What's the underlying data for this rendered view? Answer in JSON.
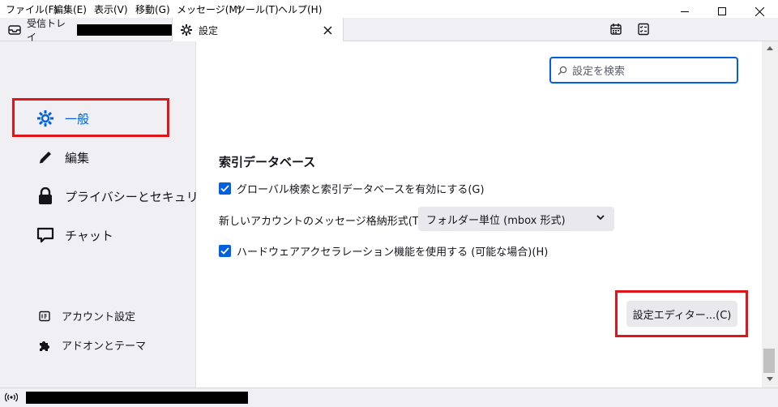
{
  "menu": {
    "items": [
      "ファイル(F)",
      "編集(E)",
      "表示(V)",
      "移動(G)",
      "メッセージ(M)",
      "ツール(T)",
      "ヘルプ(H)"
    ]
  },
  "window_controls": {
    "minimize": "—",
    "maximize": "☐",
    "close": "✕"
  },
  "tabs": [
    {
      "label": "受信トレイ",
      "icon": "mail-icon"
    },
    {
      "label": "設定",
      "icon": "gear-icon",
      "close": "✕"
    }
  ],
  "sidebar": {
    "categories": [
      {
        "label": "一般",
        "icon": "gear-icon",
        "selected": true
      },
      {
        "label": "編集",
        "icon": "pencil-icon"
      },
      {
        "label": "プライバシーとセキュリティ",
        "icon": "lock-icon"
      },
      {
        "label": "チャット",
        "icon": "chat-icon"
      }
    ],
    "footer": [
      {
        "label": "アカウント設定",
        "icon": "account-icon"
      },
      {
        "label": "アドオンとテーマ",
        "icon": "puzzle-icon"
      }
    ]
  },
  "search": {
    "placeholder": "設定を検索"
  },
  "index_section": {
    "title": "索引データベース",
    "global_search_label": "グローバル検索と索引データベースを有効にする(G)",
    "global_search_checked": true,
    "storage_label": "新しいアカウントのメッセージ格納形式(T):",
    "storage_value": "フォルダー単位 (mbox 形式)",
    "hw_accel_label": "ハードウェアアクセラレーション機能を使用する (可能な場合)(H)",
    "hw_accel_checked": true
  },
  "config_editor_button": "設定エディター...(C)",
  "colors": {
    "accent": "#0060df",
    "highlight": "#e0151b",
    "selected_text": "#0061e0"
  }
}
